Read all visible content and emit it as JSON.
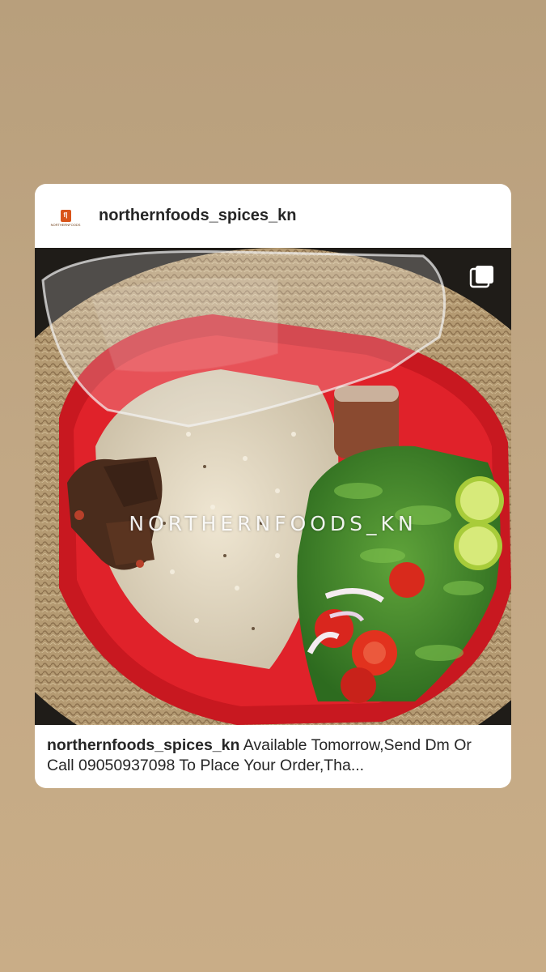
{
  "post": {
    "username": "northernfoods_spices_kn",
    "avatar_text": "NORTHERNFOODS",
    "watermark": "NORTHERNFOODS_KN",
    "caption_user": "northernfoods_spices_kn",
    "caption_text": "Available Tomorrow,Send Dm Or Call 09050937098 To Place Your Order,Tha...",
    "multi_icon": "carousel-icon"
  }
}
